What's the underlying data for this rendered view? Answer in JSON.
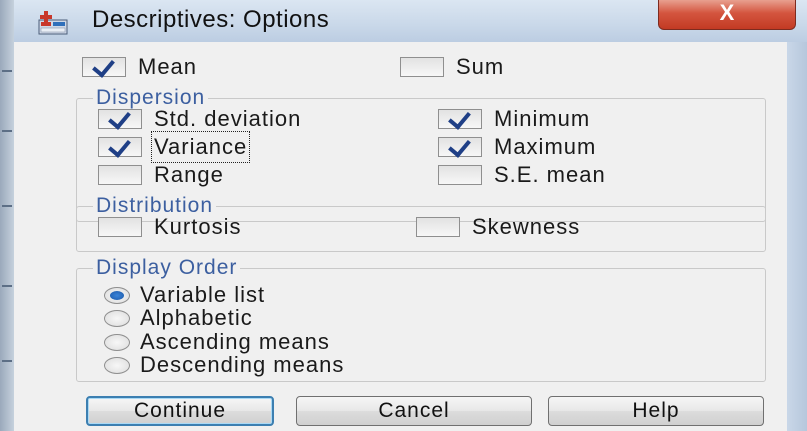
{
  "title": "Descriptives: Options",
  "close_label": "X",
  "mean_label": "Mean",
  "sum_label": "Sum",
  "dispersion": {
    "legend": "Dispersion",
    "std_label": "Std. deviation",
    "minimum_label": "Minimum",
    "variance_label": "Variance",
    "maximum_label": "Maximum",
    "range_label": "Range",
    "se_mean_label": "S.E. mean"
  },
  "distribution": {
    "legend": "Distribution",
    "kurtosis_label": "Kurtosis",
    "skewness_label": "Skewness"
  },
  "display_order": {
    "legend": "Display Order",
    "options": [
      "Variable list",
      "Alphabetic",
      "Ascending means",
      "Descending means"
    ],
    "selected": "Variable list"
  },
  "checked": {
    "mean": true,
    "sum": false,
    "std_deviation": true,
    "minimum": true,
    "variance": true,
    "maximum": true,
    "range": false,
    "se_mean": false,
    "kurtosis": false,
    "skewness": false
  },
  "buttons": {
    "continue": "Continue",
    "cancel": "Cancel",
    "help": "Help"
  },
  "colors": {
    "accent": "#3c5fa0",
    "check": "#1f3f86",
    "close": "#c23a23"
  }
}
